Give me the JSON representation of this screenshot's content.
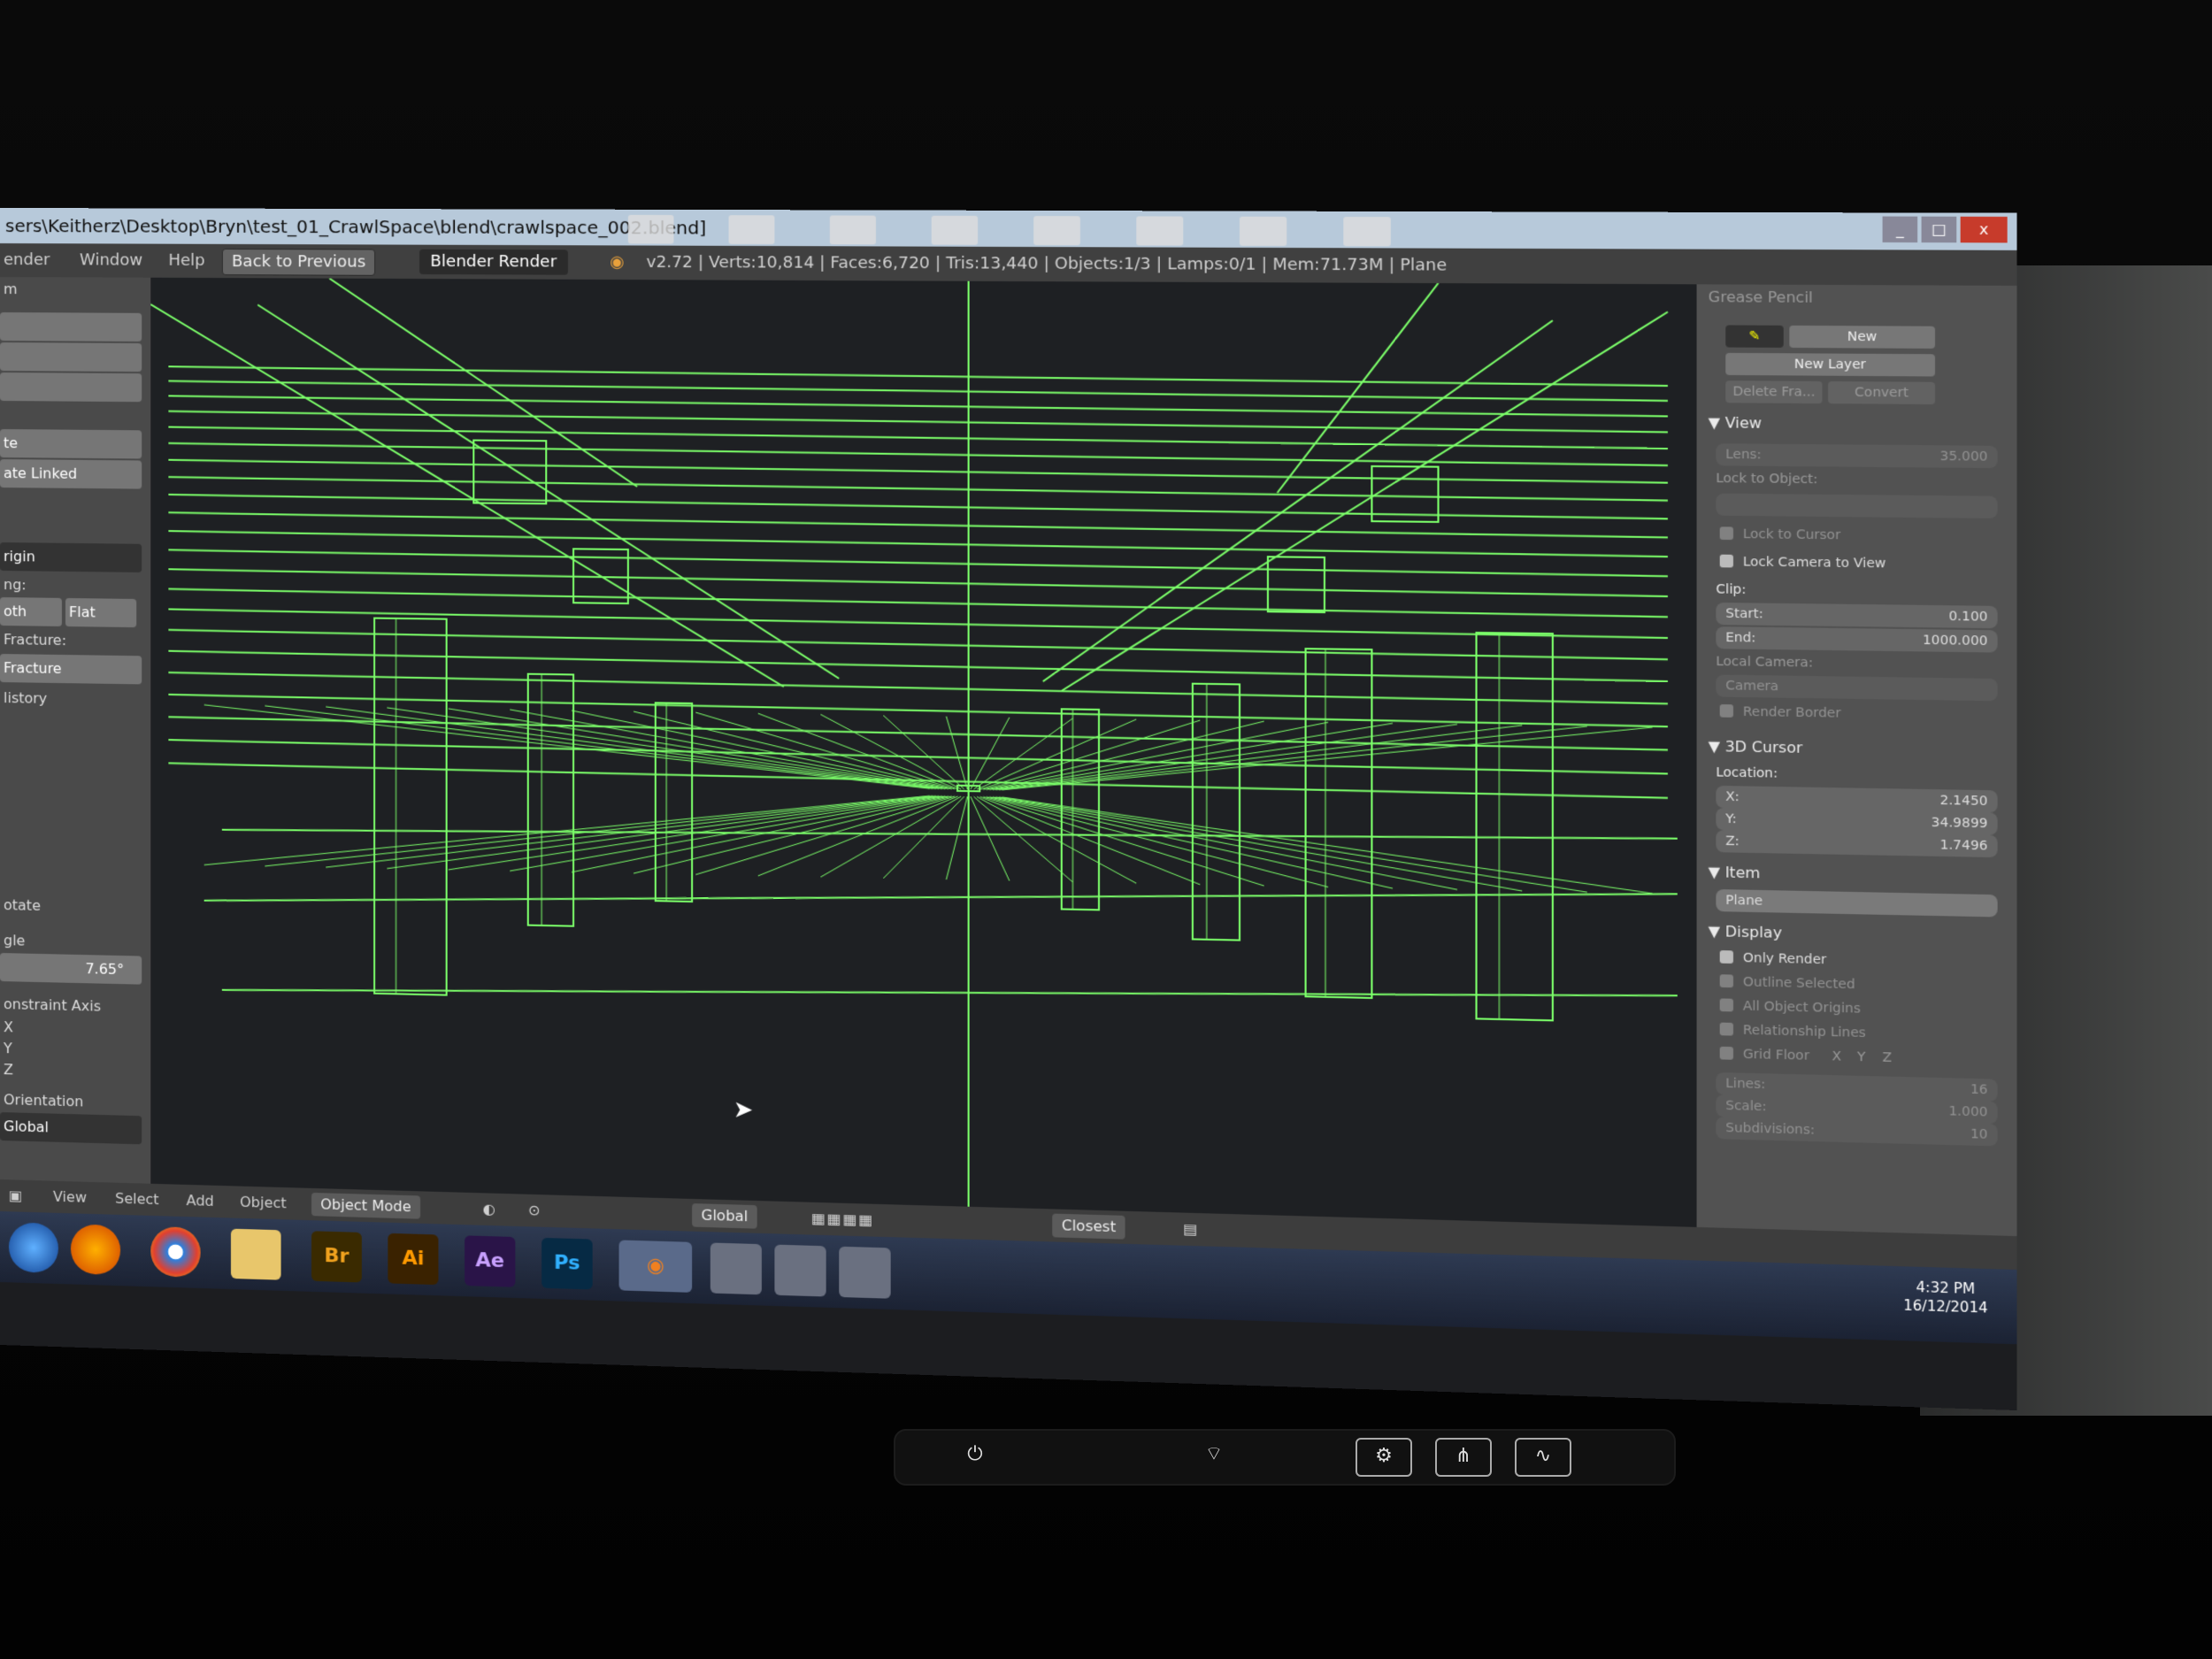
{
  "window": {
    "path": "sers\\Keitherz\\Desktop\\Bryn\\test_01_CrawlSpace\\blend\\crawlspace_002.blend]",
    "controls": [
      "_",
      "□",
      "x"
    ]
  },
  "info_bar": {
    "menus": [
      "ender",
      "Window",
      "Help"
    ],
    "back_button": "Back to Previous",
    "render_engine": "Blender Render",
    "stats": "v2.72 | Verts:10,814 | Faces:6,720 | Tris:13,440 | Objects:1/3 | Lamps:0/1 | Mem:71.73M | Plane"
  },
  "tool_shelf": {
    "header": "m",
    "items": [
      "te",
      "ate Linked",
      "rigin",
      "ng:",
      "oth",
      "Flat",
      "Fracture:",
      "Fracture",
      "listory",
      "otate",
      "gle",
      "7.65°",
      "onstraint Axis",
      "X",
      "Y",
      "Z",
      "Orientation",
      "Global"
    ]
  },
  "properties_panel": {
    "grease_pencil": {
      "header": "Grease Pencil",
      "new": "New",
      "new_layer": "New Layer",
      "delete_frame": "Delete Fra...",
      "convert": "Convert"
    },
    "view": {
      "header": "View",
      "lens_label": "Lens:",
      "lens_value": "35.000",
      "lock_to_object": "Lock to Object:",
      "lock_to_cursor": "Lock to Cursor",
      "lock_camera_to_view": "Lock Camera to View",
      "clip": "Clip:",
      "start_label": "Start:",
      "start_value": "0.100",
      "end_label": "End:",
      "end_value": "1000.000",
      "local_camera": "Local Camera:",
      "camera": "Camera",
      "render_border": "Render Border"
    },
    "cursor": {
      "header": "3D Cursor",
      "location": "Location:",
      "x_label": "X:",
      "x_value": "2.1450",
      "y_label": "Y:",
      "y_value": "34.9899",
      "z_label": "Z:",
      "z_value": "1.7496"
    },
    "item": {
      "header": "Item",
      "name": "Plane"
    },
    "display": {
      "header": "Display",
      "only_render": "Only Render",
      "outline_selected": "Outline Selected",
      "all_object_origins": "All Object Origins",
      "relationship_lines": "Relationship Lines",
      "grid_floor": "Grid Floor",
      "axes": [
        "X",
        "Y",
        "Z"
      ],
      "lines_label": "Lines:",
      "lines_value": "16",
      "scale_label": "Scale:",
      "scale_value": "1.000",
      "subdivisions_label": "Subdivisions:",
      "subdivisions_value": "10"
    }
  },
  "header_3d": {
    "menus": [
      "View",
      "Select",
      "Add",
      "Object"
    ],
    "mode": "Object Mode",
    "orientation": "Global",
    "snap": "Closest"
  },
  "taskbar": {
    "apps": [
      "Br",
      "Ai",
      "Ae",
      "Ps"
    ],
    "time": "4:32 PM",
    "date": "16/12/2014"
  },
  "wire_color": "#7cff6a",
  "accent_colors": {
    "bridge": "#2f3b55",
    "ae": "#2a1448",
    "ai": "#3a2200",
    "br": "#3a2a00",
    "ps": "#062a44"
  }
}
